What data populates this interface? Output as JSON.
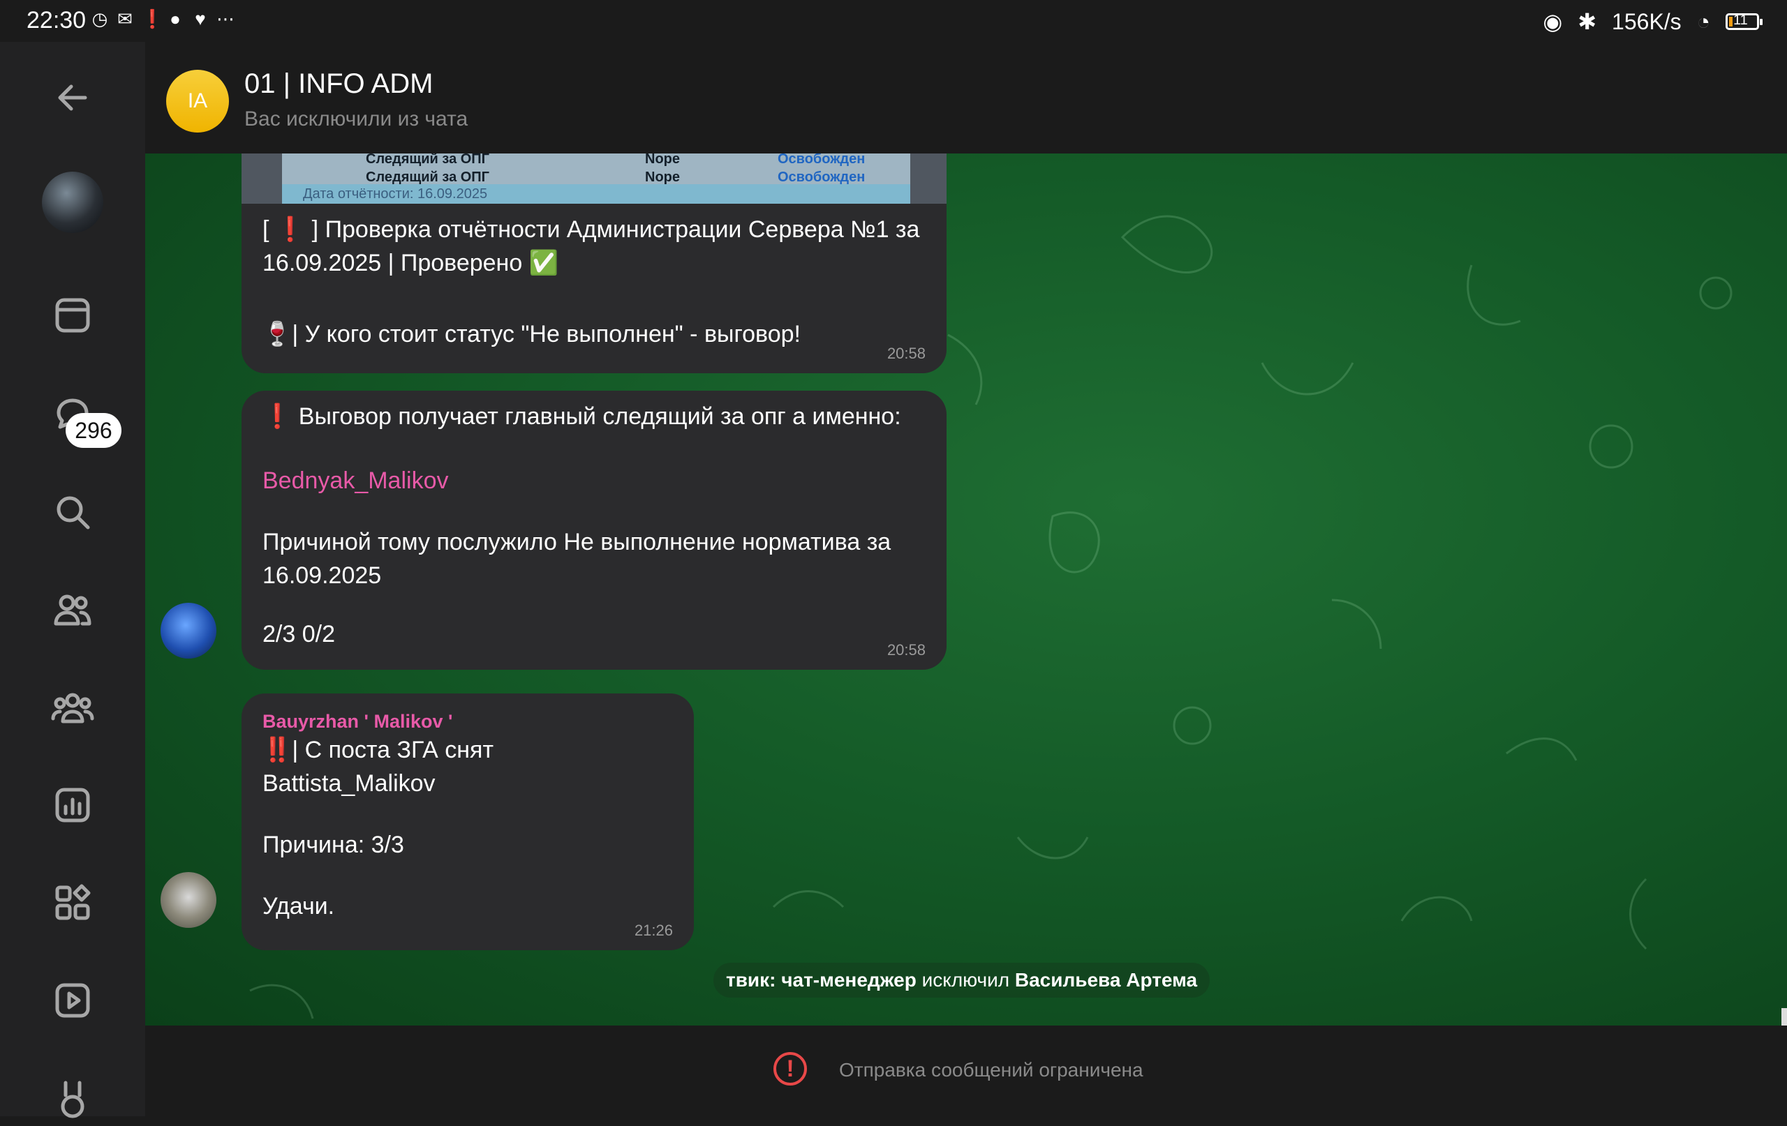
{
  "status_bar": {
    "time": "22:30",
    "left_icons": [
      "clock-icon",
      "mail-icon",
      "alert-icon",
      "chat-icon",
      "heart-icon",
      "more-icon"
    ],
    "network_speed": "156K/s",
    "battery_level": "11"
  },
  "sidebar": {
    "unread_badge": "296",
    "items": [
      "back-icon",
      "avatar",
      "archive-icon",
      "chats-icon",
      "search-icon",
      "contacts-icon",
      "groups-icon",
      "stats-icon",
      "apps-icon",
      "video-icon",
      "bunny-icon"
    ]
  },
  "header": {
    "avatar_initials": "IA",
    "title": "01 | INFO ADM",
    "subtitle": "Вас исключили из чата"
  },
  "messages": [
    {
      "image_table": {
        "rows": [
          {
            "role": "Следящий за ОПГ",
            "value": "Nope",
            "status": "Освобожден"
          },
          {
            "role": "Следящий за ОПГ",
            "value": "Nope",
            "status": "Освобожден"
          }
        ],
        "caption": "Дата отчётности: 16.09.2025"
      },
      "text_line1": "[ ❗ ] Проверка отчётности Администрации Сервера №1 за 16.09.2025 | Проверено ✅",
      "text_line2": "🍷| У кого стоит статус \"Не выполнен\" - выговор!",
      "time": "20:58"
    },
    {
      "text_line1": "❗ Выговор получает главный следящий за опг а именно:",
      "mention": "Bednyak_Malikov",
      "text_line2": "Причиной тому послужило Не выполнение норматива за 16.09.2025",
      "text_line3": "2/3 0/2",
      "time": "20:58"
    },
    {
      "sender": "Bauyrzhan ' Malikov '",
      "text_line1": "‼️| С поста ЗГА снят",
      "text_line2": "Battista_Malikov",
      "text_line3": "Причина: 3/3",
      "text_line4": "Удачи.",
      "time": "21:26"
    }
  ],
  "system_message": {
    "actor": "твик: чат-менеджер",
    "action": "исключил",
    "target": "Васильева Артема"
  },
  "footer": {
    "text": "Отправка сообщений ограничена"
  }
}
